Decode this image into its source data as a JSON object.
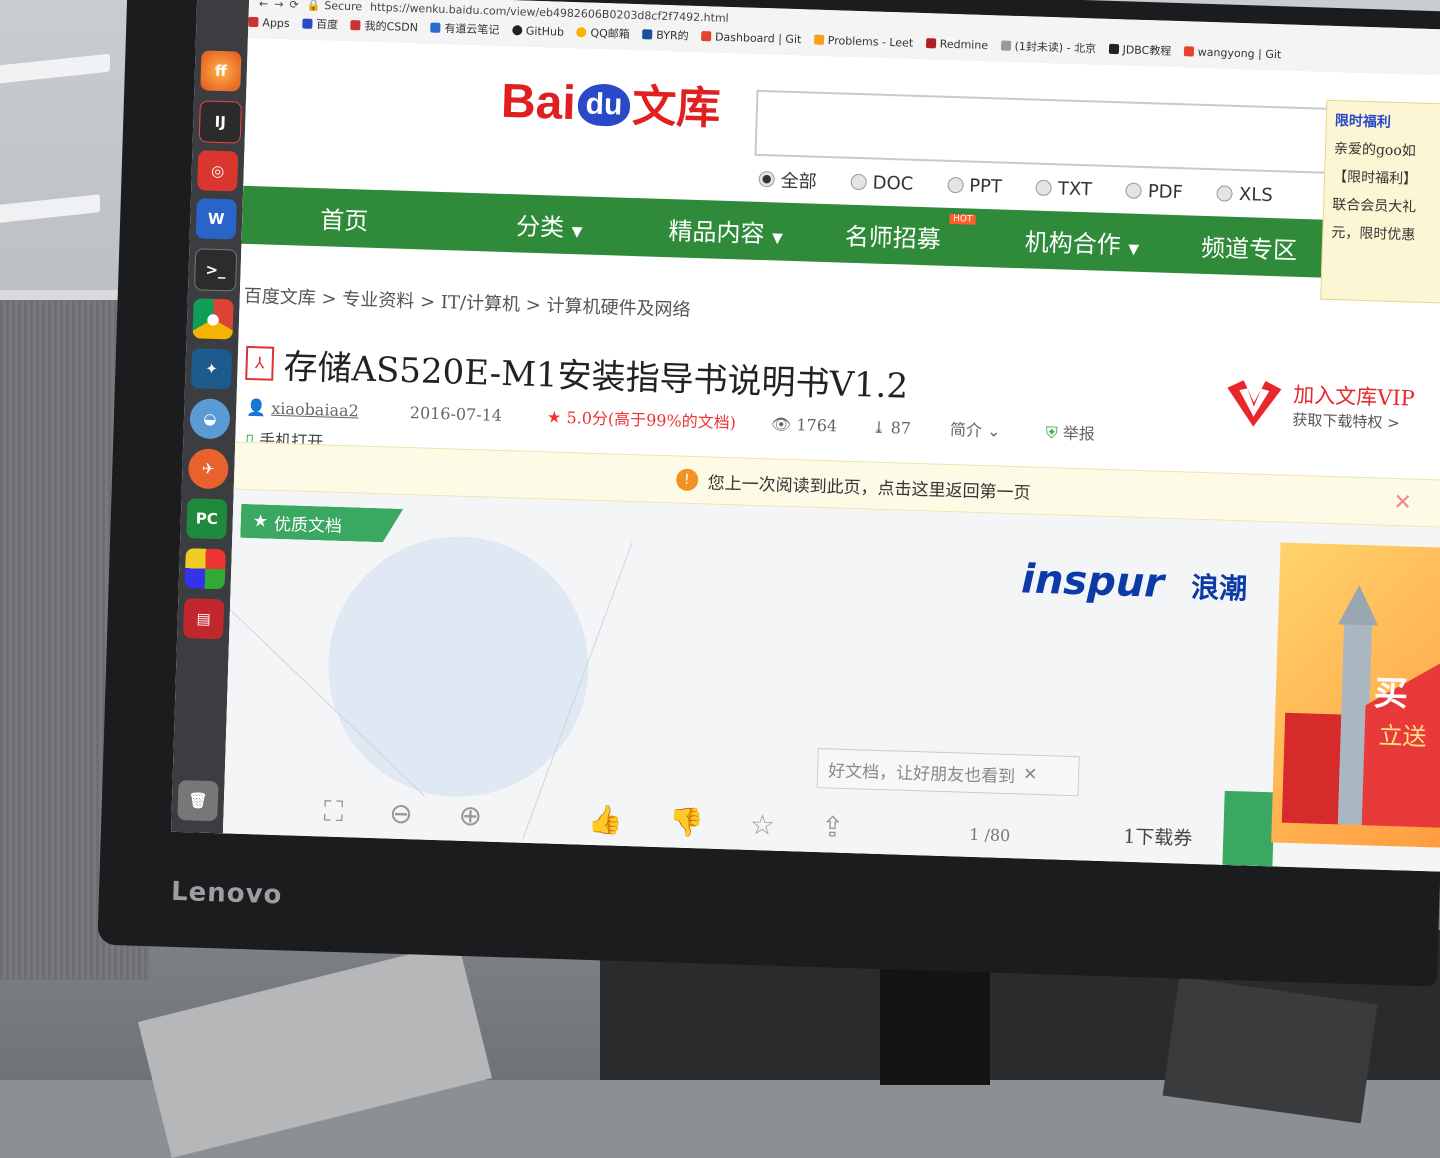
{
  "browser": {
    "secure_label": "Secure",
    "url": "https://wenku.baidu.com/view/eb4982606B0203d8cf2f7492.html",
    "bookmarks": [
      "Apps",
      "百度",
      "我的CSDN",
      "有道云笔记",
      "GitHub",
      "QQ邮箱",
      "BYR的",
      "Dashboard | Git",
      "Problems - Leet",
      "Redmine",
      "(1封未读) - 北京",
      "JDBC教程",
      "wangyong | Git"
    ]
  },
  "page": {
    "logo_text": "Bai",
    "logo_du": "du",
    "logo_cn": "文库",
    "search_types": [
      "全部",
      "DOC",
      "PPT",
      "TXT",
      "PDF",
      "XLS"
    ],
    "nav": {
      "home": "首页",
      "category": "分类",
      "featured": "精品内容",
      "teacher": "名师招募",
      "hot_badge": "HOT",
      "institution": "机构合作",
      "channel": "频道专区"
    },
    "promo": {
      "title": "限时福利",
      "line1": "亲爱的goo如",
      "line2": "【限时福利】",
      "line3": "联合会员大礼",
      "line4": "元，限时优惠"
    },
    "breadcrumb": [
      "百度文库",
      "专业资料",
      "IT/计算机",
      "计算机硬件及网络"
    ],
    "breadcrumb_sep": ">",
    "doc": {
      "title": "存储AS520E-M1安装指导书说明书V1.2",
      "author": "xiaobaiaa2",
      "date": "2016-07-14",
      "rating": "5.0分(高于99%的文档)",
      "views": "1764",
      "downloads": "87",
      "intro": "简介",
      "report": "举报",
      "mobile_open": "手机打开"
    },
    "vip": {
      "title": "加入文库VIP",
      "subtitle": "获取下载特权 >"
    },
    "notice": "您上一次阅读到此页，点击这里返回第一页",
    "viewer": {
      "quality_badge": "优质文档",
      "brand_en": "inspur",
      "brand_cn": "浪潮",
      "share_tip": "好文档，让好朋友也看到",
      "page_current": "1",
      "page_total": "/80",
      "coupon": "1下载券",
      "ad_text": "买",
      "ad_text2": "立送"
    }
  },
  "monitor_brand": "Lenovo",
  "colors": {
    "nav_green": "#2f8b3a",
    "baidu_red": "#e02020",
    "baidu_blue": "#2a49c8",
    "vip_red": "#e8262b",
    "inspur_blue": "#0c3aa7"
  }
}
